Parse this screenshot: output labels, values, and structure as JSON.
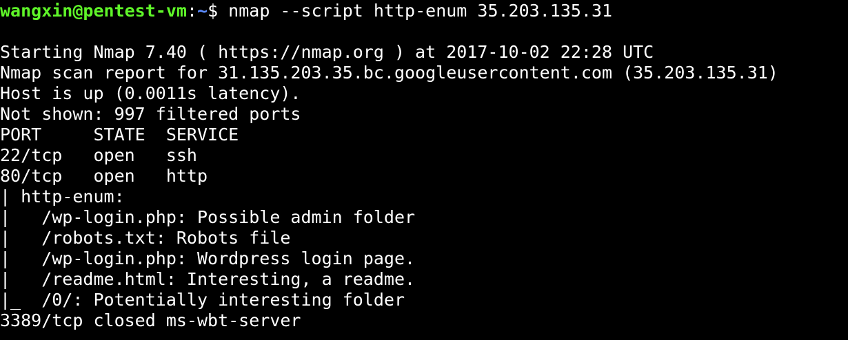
{
  "prompt": {
    "user_host": "wangxin@pentest-vm",
    "separator": ":",
    "path": "~",
    "symbol": "$ ",
    "command": "nmap --script http-enum 35.203.135.31"
  },
  "output": [
    "Starting Nmap 7.40 ( https://nmap.org ) at 2017-10-02 22:28 UTC",
    "Nmap scan report for 31.135.203.35.bc.googleusercontent.com (35.203.135.31)",
    "Host is up (0.0011s latency).",
    "Not shown: 997 filtered ports",
    "PORT     STATE  SERVICE",
    "22/tcp   open   ssh",
    "80/tcp   open   http",
    "| http-enum: ",
    "|   /wp-login.php: Possible admin folder",
    "|   /robots.txt: Robots file",
    "|   /wp-login.php: Wordpress login page.",
    "|   /readme.html: Interesting, a readme.",
    "|_  /0/: Potentially interesting folder",
    "3389/tcp closed ms-wbt-server"
  ],
  "colors": {
    "background": "#000000",
    "text": "#ffffff",
    "user_host": "#5ff529",
    "path": "#5c8bff"
  }
}
